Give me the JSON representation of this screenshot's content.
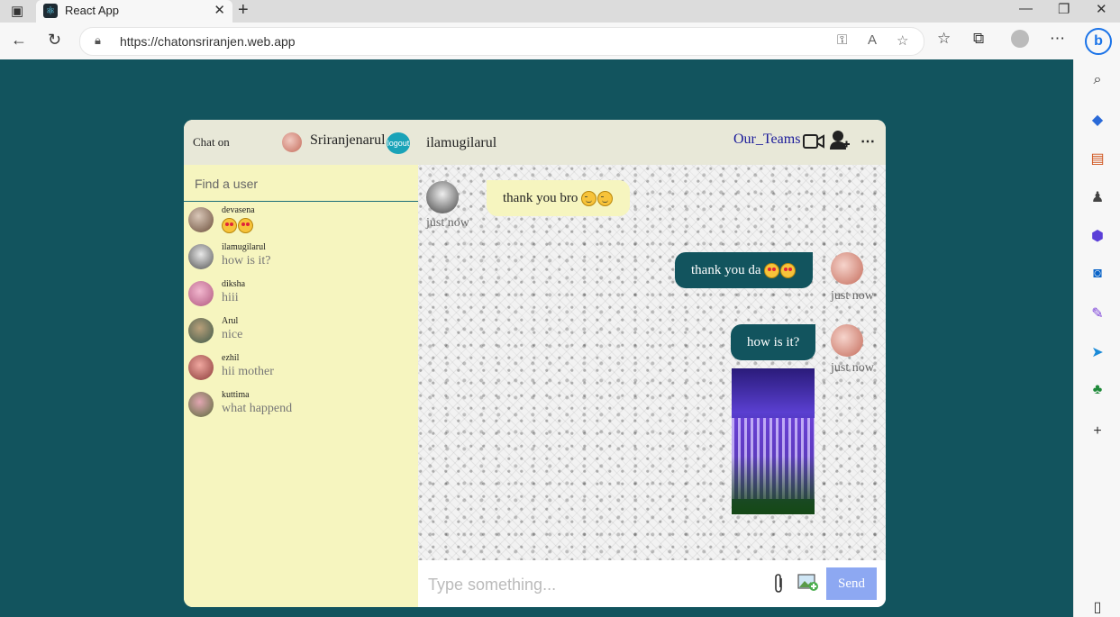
{
  "browser": {
    "tab_title": "React App",
    "url": "https://chatonsriranjen.web.app"
  },
  "app": {
    "brand": "Chat on",
    "current_user": "Sriranjenarul",
    "logout_label": "logout",
    "search_placeholder": "Find a user",
    "chats": [
      {
        "name": "devasena",
        "last_message": "",
        "last_emoji": "heart-eyes heart-eyes"
      },
      {
        "name": "ilamugilarul",
        "last_message": "how is it?"
      },
      {
        "name": "diksha",
        "last_message": "hiii"
      },
      {
        "name": "Arul",
        "last_message": "nice"
      },
      {
        "name": "ezhil",
        "last_message": "hii mother"
      },
      {
        "name": "kuttima",
        "last_message": "what happend"
      }
    ],
    "conversation": {
      "peer_name": "ilamugilarul",
      "teams_link": "Our_Teams",
      "messages": [
        {
          "direction": "in",
          "text": "thank you bro",
          "emoji": "wink wink",
          "time": "just now"
        },
        {
          "direction": "out",
          "text": "thank you da",
          "emoji": "heart-eyes heart-eyes",
          "time": "just now"
        },
        {
          "direction": "out",
          "text": "how is it?",
          "time": "just now",
          "image": "waterfall-photo"
        }
      ],
      "input_placeholder": "Type something...",
      "send_label": "Send"
    }
  },
  "colors": {
    "page_bg": "#12545e",
    "sidebar_bg": "#f6f5bf",
    "header_bg": "#e8e8d8",
    "outgoing_bubble": "#12545e",
    "send_button": "#8da8f2"
  }
}
